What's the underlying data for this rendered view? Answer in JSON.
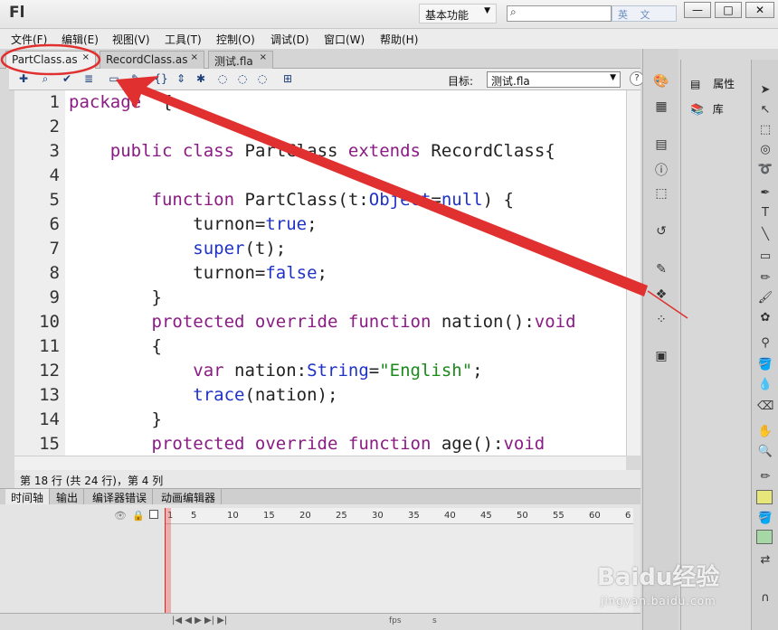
{
  "app": {
    "logo": "Fl",
    "workspace": "基本功能",
    "ime": "英 文"
  },
  "window_buttons": {
    "minimize": "—",
    "maximize": "□",
    "close": "✕"
  },
  "menu": [
    "文件(F)",
    "编辑(E)",
    "视图(V)",
    "工具(T)",
    "控制(O)",
    "调试(D)",
    "窗口(W)",
    "帮助(H)"
  ],
  "tabs": [
    {
      "label": "PartClass.as",
      "close": "×",
      "active": true
    },
    {
      "label": "RecordClass.as",
      "close": "×",
      "active": false
    },
    {
      "label": "测试.fla",
      "close": "×",
      "active": false
    }
  ],
  "toolbar": {
    "target_label": "目标:",
    "target_value": "测试.fla",
    "help": "?"
  },
  "code": {
    "line_numbers": [
      "1",
      "2",
      "3",
      "4",
      "5",
      "6",
      "7",
      "8",
      "9",
      "10",
      "11",
      "12",
      "13",
      "14",
      "15"
    ],
    "lines": [
      "package  {",
      "",
      "    public class PartClass extends RecordClass{",
      "",
      "        function PartClass(t:Object=null) {",
      "            turnon=true;",
      "            super(t);",
      "            turnon=false;",
      "        }",
      "        protected override function nation():void",
      "        {",
      "            var nation:String=\"English\";",
      "            trace(nation);",
      "        }",
      "        protected override function age():void"
    ]
  },
  "status": "第 18 行 (共 24 行)，第 4 列",
  "bottom_tabs": [
    "时间轴",
    "输出",
    "编译器错误",
    "动画编辑器"
  ],
  "timeline": {
    "ticks": [
      "1",
      "5",
      "10",
      "15",
      "20",
      "25",
      "30",
      "35",
      "40",
      "45",
      "50",
      "55",
      "60",
      "6"
    ],
    "fps_label": "fps",
    "s_label": "s"
  },
  "right_panel": {
    "properties": "属性",
    "library": "库"
  },
  "watermark": {
    "brand": "Baidu经验",
    "url": "jingyan.baidu.com"
  },
  "colors": {
    "keyword": "#8a1b84",
    "builtin": "#1f32c6",
    "string": "#1a8a1a",
    "annotation": "#e03030"
  }
}
